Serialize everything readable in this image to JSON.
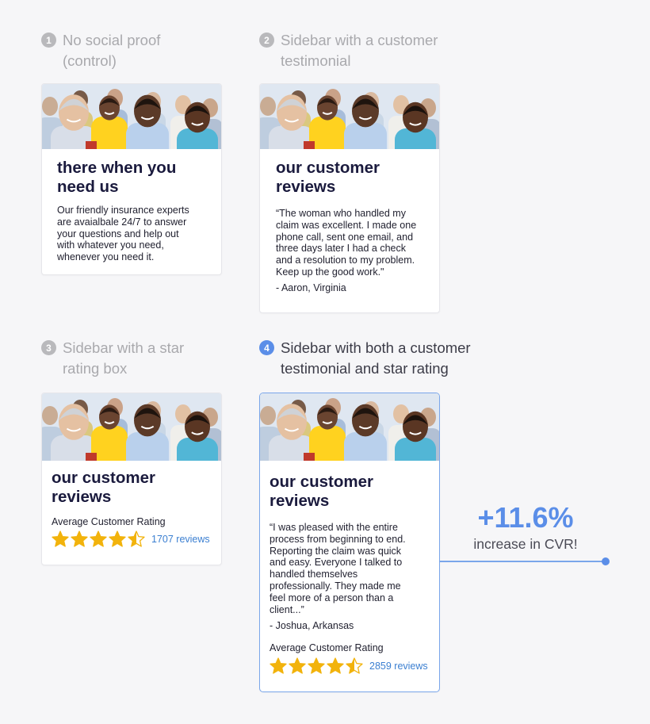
{
  "variants": [
    {
      "number": "1",
      "heading": [
        "No social proof",
        "(control)"
      ],
      "title": [
        "there when you",
        "need us"
      ],
      "body": [
        "Our friendly insurance experts",
        "are avaialbale 24/7 to answer",
        "your questions and help out",
        "with whatever you need,",
        "whenever you need it."
      ]
    },
    {
      "number": "2",
      "heading": [
        "Sidebar with a customer",
        "testimonial"
      ],
      "title": [
        "our customer",
        "reviews"
      ],
      "quote": [
        "“The woman who handled my",
        "claim was excellent. I made one",
        "phone call, sent one email, and",
        "three days later I had a check",
        "and a resolution to my problem.",
        "Keep up the good work.\""
      ],
      "author": "- Aaron, Virginia"
    },
    {
      "number": "3",
      "heading": [
        "Sidebar with a star",
        "rating box"
      ],
      "title": [
        "our customer",
        "reviews"
      ],
      "rating_label": "Average Customer Rating",
      "rating_stars": 4.5,
      "review_count": "1707 reviews"
    },
    {
      "number": "4",
      "heading": [
        "Sidebar with both a customer",
        "testimonial and star rating"
      ],
      "title": [
        "our customer",
        "reviews"
      ],
      "quote": [
        "“I was pleased with the entire",
        "process from beginning to end.",
        "Reporting the claim was quick",
        "and easy. Everyone I talked to",
        "handled themselves",
        "professionally. They made me",
        "feel more of a person than a",
        "client...”"
      ],
      "author": "- Joshua, Arkansas",
      "rating_label": "Average Customer Rating",
      "rating_stars": 4.5,
      "review_count": "2859 reviews"
    }
  ],
  "result": {
    "value": "+11.6%",
    "label": "increase in CVR!"
  },
  "colors": {
    "accent": "#5b8ee8",
    "star": "#f2b30c",
    "link": "#3b7fd1",
    "title": "#1a1a3d"
  },
  "icons": {
    "star": "star-icon",
    "half_star": "half-star-icon"
  }
}
